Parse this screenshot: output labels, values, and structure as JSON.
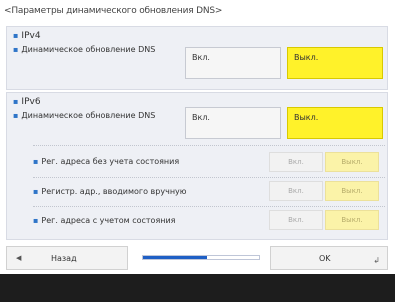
{
  "title": "<Параметры динамического обновления DNS>",
  "ipv4": {
    "label": "IPv4",
    "row_label": "Динамическое обновление DNS",
    "on_label": "Вкл.",
    "off_label": "Выкл.",
    "selected": "off"
  },
  "ipv6": {
    "label": "IPv6",
    "row_label": "Динамическое обновление DNS",
    "on_label": "Вкл.",
    "off_label": "Выкл.",
    "selected": "off",
    "suboptions": [
      {
        "label": "Рег. адреса без учета состояния",
        "on_label": "Вкл.",
        "off_label": "Выкл.",
        "selected": "off",
        "enabled": false
      },
      {
        "label": "Регистр. адр., вводимого вручную",
        "on_label": "Вкл.",
        "off_label": "Выкл.",
        "selected": "off",
        "enabled": false
      },
      {
        "label": "Рег. адреса с учетом состояния",
        "on_label": "Вкл.",
        "off_label": "Выкл.",
        "selected": "off",
        "enabled": false
      }
    ]
  },
  "footer": {
    "back_label": "Назад",
    "ok_label": "OK",
    "progress": 0.55,
    "back_icon": "left-arrow-icon",
    "enter_icon": "enter-icon"
  },
  "colors": {
    "selected": "#fff22a",
    "progress": "#1e5fc5",
    "bullet": "#2f75c8"
  }
}
